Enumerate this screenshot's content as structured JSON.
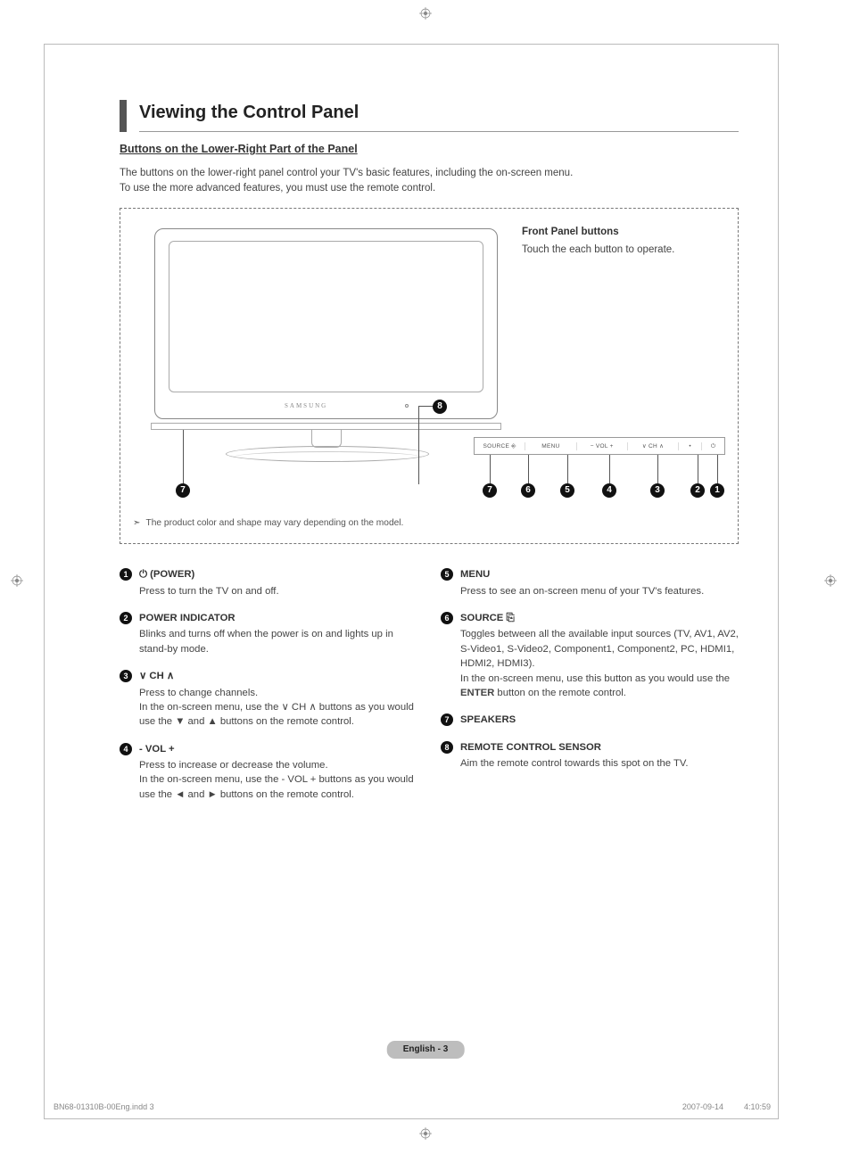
{
  "heading": "Viewing the Control Panel",
  "sub_heading": "Buttons on the Lower-Right Part of the Panel",
  "intro1": "The buttons on the lower-right panel control your TV's basic features, including the on-screen menu.",
  "intro2": "To use the more advanced features, you must use the remote control.",
  "front_panel": {
    "title": "Front Panel buttons",
    "text": "Touch the each button to operate."
  },
  "tv_brand": "SAMSUNG",
  "strip": {
    "source": "SOURCE",
    "menu": "MENU",
    "vol": "−  VOL  +",
    "ch": "∨  CH  ∧",
    "dot": "•",
    "power": "⏻"
  },
  "diagram_note": "The product color and shape may vary depending on the model.",
  "badges": {
    "b1": "1",
    "b2": "2",
    "b3": "3",
    "b4": "4",
    "b5": "5",
    "b6": "6",
    "b7": "7",
    "b8": "8"
  },
  "items_left": [
    {
      "n": "1",
      "title": "⏻ (POWER)",
      "desc": "Press to turn the TV on and off."
    },
    {
      "n": "2",
      "title": "POWER INDICATOR",
      "desc": "Blinks and turns off when the power is on and lights up in stand-by mode."
    },
    {
      "n": "3",
      "title": "∨  CH  ∧",
      "desc": "Press to change channels.\nIn the on-screen menu, use the ∨ CH ∧ buttons as you would use the ▼ and ▲ buttons on the remote control."
    },
    {
      "n": "4",
      "title": "- VOL +",
      "desc": "Press to increase or decrease the volume.\nIn the on-screen menu, use the - VOL + buttons as you would use the ◄ and ► buttons on the remote control."
    }
  ],
  "items_right": [
    {
      "n": "5",
      "title": "MENU",
      "desc": "Press to see an on-screen menu of your TV's features."
    },
    {
      "n": "6",
      "title": "SOURCE ⎘",
      "desc": "Toggles between all the available input sources (TV, AV1, AV2, S-Video1, S-Video2, Component1, Component2, PC, HDMI1, HDMI2, HDMI3).\nIn the on-screen menu, use this button as you would use the ENTER button on the remote control.",
      "enter_bold": "ENTER"
    },
    {
      "n": "7",
      "title": "SPEAKERS",
      "desc": ""
    },
    {
      "n": "8",
      "title": "REMOTE CONTROL SENSOR",
      "desc": "Aim the remote control towards this spot on the TV."
    }
  ],
  "page_pill": "English - 3",
  "footer_left": "BN68-01310B-00Eng.indd   3",
  "footer_right": "2007-09-14      4:10:59"
}
